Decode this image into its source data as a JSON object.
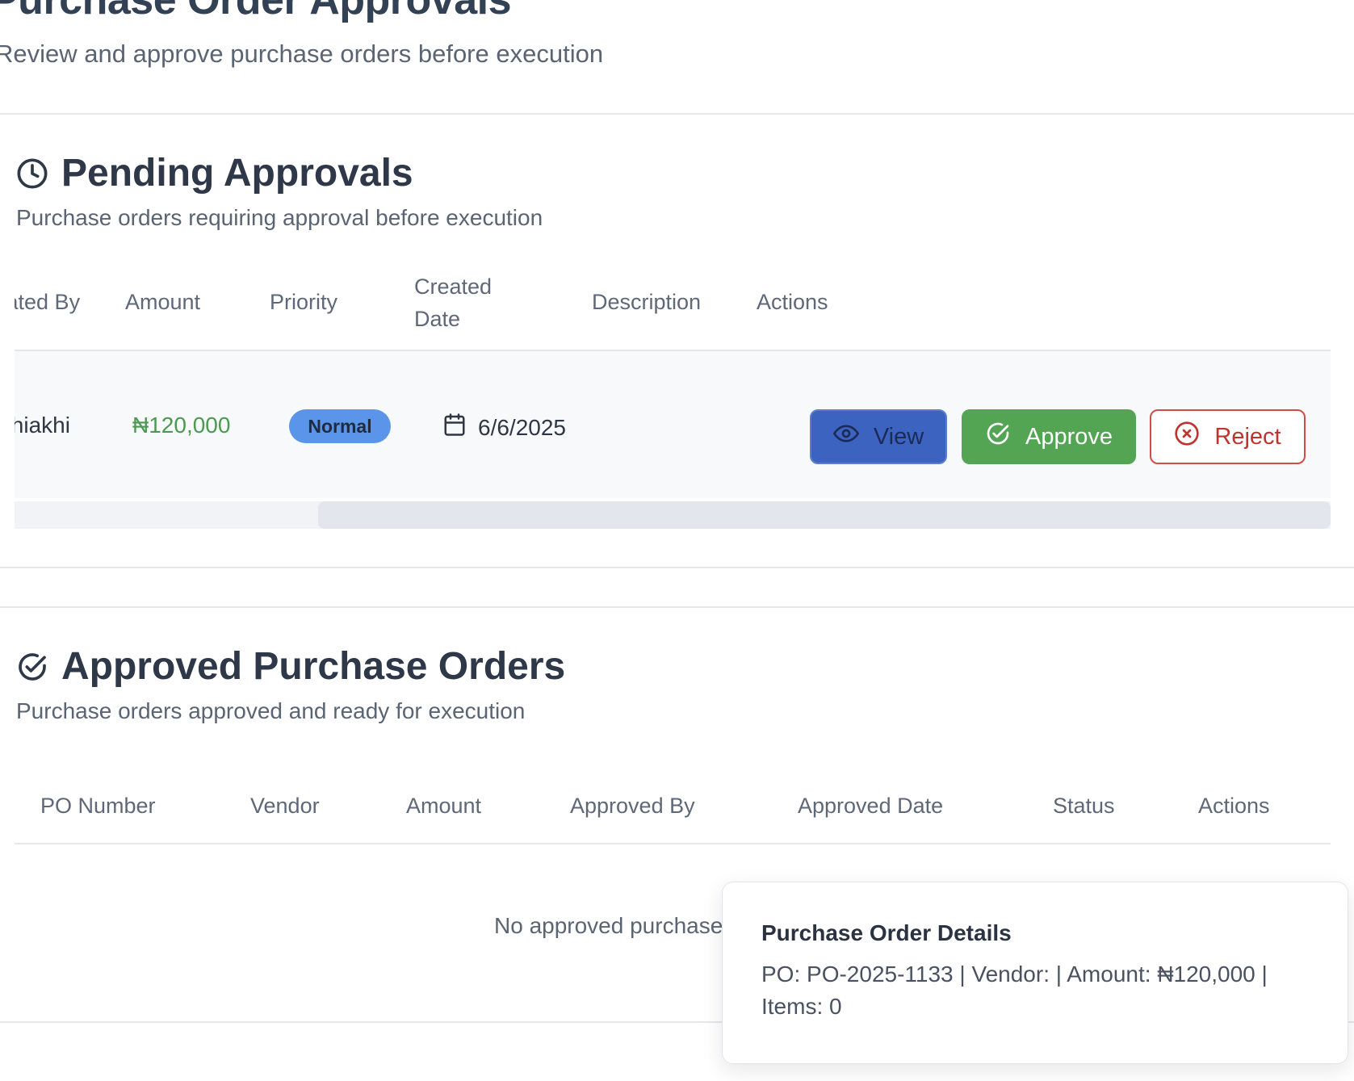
{
  "page": {
    "title": "Purchase Order Approvals",
    "subtitle": "Review and approve purchase orders before execution"
  },
  "pending": {
    "title": "Pending Approvals",
    "description": "Purchase orders requiring approval before execution",
    "icon": "clock-icon",
    "columns": [
      "Created By",
      "Amount",
      "Priority",
      "Created Date",
      "Description",
      "Actions"
    ],
    "rows": [
      {
        "created_by": "Ughiakhi",
        "amount": "₦120,000",
        "priority": "Normal",
        "created_date": "6/6/2025",
        "description": "",
        "actions": {
          "view": "View",
          "approve": "Approve",
          "reject": "Reject"
        }
      }
    ]
  },
  "approved": {
    "title": "Approved Purchase Orders",
    "description": "Purchase orders approved and ready for execution",
    "icon": "check-circle-icon",
    "columns": [
      "PO Number",
      "Vendor",
      "Amount",
      "Approved By",
      "Approved Date",
      "Status",
      "Actions"
    ],
    "empty_message": "No approved purchase orders"
  },
  "popover": {
    "title": "Purchase Order Details",
    "body": "PO: PO-2025-1133 | Vendor: | Amount: ₦120,000 | Items: 0"
  },
  "colors": {
    "view_button": "#3d63c1",
    "approve_button": "#53a553",
    "reject_border": "#d04c47",
    "priority_badge": "#5b95ea",
    "amount_text": "#4a9a4f"
  }
}
